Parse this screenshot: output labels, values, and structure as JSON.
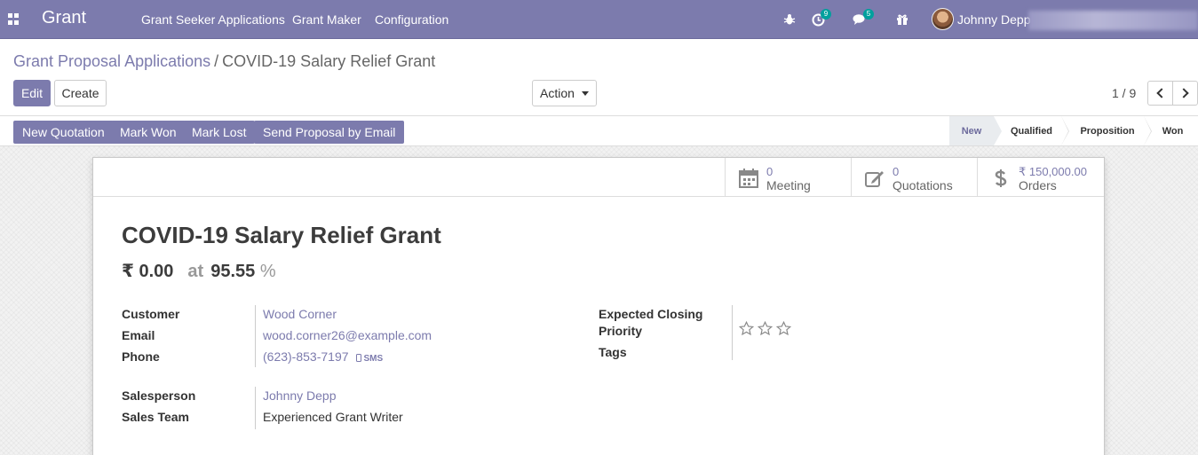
{
  "navbar": {
    "brand": "Grant",
    "menu": [
      "Grant Seeker Applications",
      "Grant Maker",
      "Configuration"
    ],
    "activity_count": "9",
    "messages_count": "5",
    "user_name": "Johnny Depp"
  },
  "control": {
    "breadcrumb_parent": "Grant Proposal Applications",
    "breadcrumb_sep": "/",
    "breadcrumb_current": "COVID-19 Salary Relief Grant",
    "edit_label": "Edit",
    "create_label": "Create",
    "action_label": "Action",
    "pager": "1 / 9"
  },
  "statusbar": {
    "buttons": [
      "New Quotation",
      "Mark Won",
      "Mark Lost",
      "Send Proposal by Email"
    ],
    "stages": [
      "New",
      "Qualified",
      "Proposition",
      "Won"
    ],
    "active_stage": "New"
  },
  "smart_buttons": [
    {
      "value": "0",
      "label": "Meeting",
      "icon": "calendar-icon"
    },
    {
      "value": "0",
      "label": "Quotations",
      "icon": "edit-icon"
    },
    {
      "value": "₹ 150,000.00",
      "label": "Orders",
      "icon": "dollar-icon"
    }
  ],
  "record": {
    "title": "COVID-19 Salary Relief Grant",
    "expected_revenue": "₹ 0.00",
    "at_label": "at",
    "probability": "95.55",
    "percent_sign": "%"
  },
  "fields": {
    "customer_label": "Customer",
    "customer": "Wood Corner",
    "email_label": "Email",
    "email": "wood.corner26@example.com",
    "phone_label": "Phone",
    "phone": "(623)-853-7197",
    "sms_label": "SMS",
    "salesperson_label": "Salesperson",
    "salesperson": "Johnny Depp",
    "sales_team_label": "Sales Team",
    "sales_team": "Experienced Grant Writer",
    "expected_closing_label": "Expected Closing",
    "priority_label": "Priority",
    "tags_label": "Tags",
    "priority_stars": 0
  },
  "colors": {
    "brand": "#7c7bad",
    "badge": "#00a09d"
  }
}
